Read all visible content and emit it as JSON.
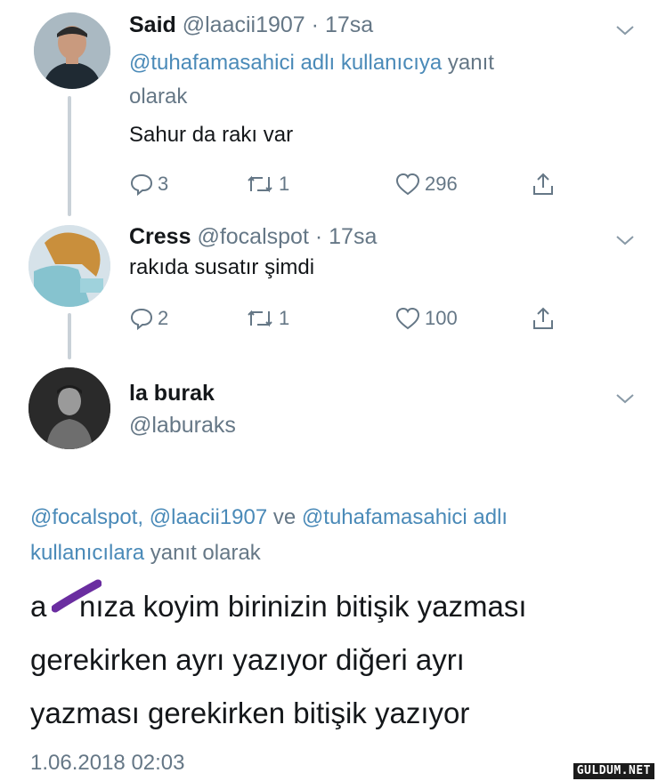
{
  "colors": {
    "link": "#4a8ab8",
    "muted": "#657786",
    "text": "#14171a",
    "thread": "#c9d1d8"
  },
  "tweet1": {
    "name": "Said",
    "handle": "@laacii1907",
    "time": "· 17sa",
    "reply_mention": "@tuhafamasahici adlı kullanıcıya",
    "reply_suffix": " yanıt",
    "reply_line2": "olarak",
    "text": "Sahur da rakı var",
    "replies": "3",
    "retweets": "1",
    "likes": "296"
  },
  "tweet2": {
    "name": "Cress",
    "handle": "@focalspot",
    "time": "· 17sa",
    "text": "rakıda susatır şimdi",
    "replies": "2",
    "retweets": "1",
    "likes": "100"
  },
  "tweet3": {
    "name": "la burak",
    "handle": "@laburaks",
    "reply_m1": "@focalspot,",
    "reply_m2": "@laacii1907",
    "reply_ve": "ve",
    "reply_m3": "@tuhafamasahici adlı",
    "reply_m4": "kullanıcılara",
    "reply_suffix": " yanıt olarak",
    "text_line1": "a    nıza koyim birinizin bitişik yazması",
    "text_line2": "gerekirken ayrı yazıyor diğeri ayrı",
    "text_line3": "yazması gerekirken bitişik yazıyor",
    "date": "1.06.2018 02:03"
  },
  "watermark": "GULDUM.NET",
  "icons": [
    "reply-icon",
    "retweet-icon",
    "like-icon",
    "share-icon",
    "chevron-down-icon"
  ]
}
